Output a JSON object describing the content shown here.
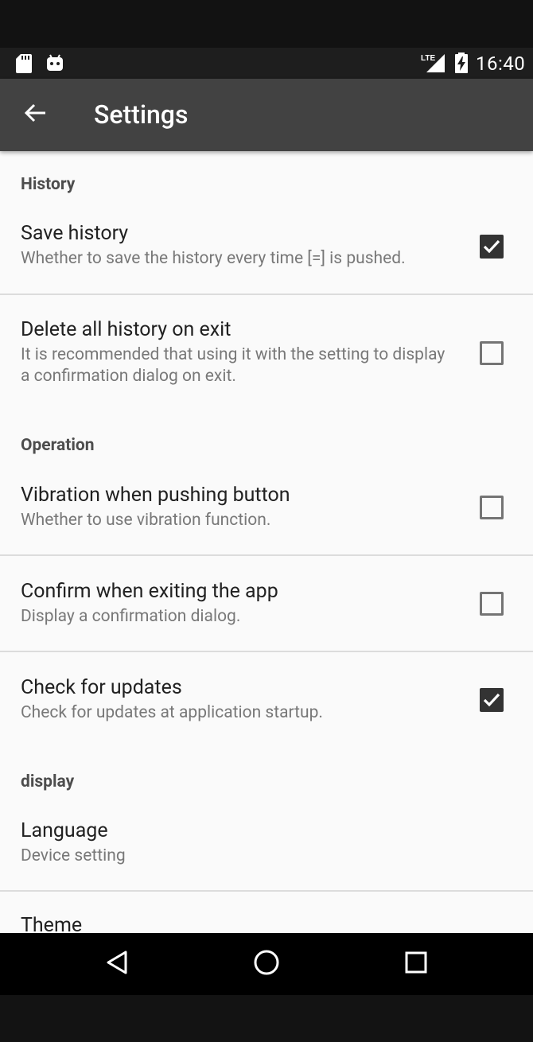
{
  "status_bar": {
    "time": "16:40",
    "network_label": "LTE",
    "icons": [
      "sd-card-icon",
      "android-icon",
      "lte-signal-icon",
      "battery-charging-icon"
    ]
  },
  "toolbar": {
    "title": "Settings",
    "back_icon": "arrow-back-icon"
  },
  "categories": {
    "history": "History",
    "operation": "Operation",
    "display": "display"
  },
  "prefs": {
    "save_history": {
      "title": "Save history",
      "summary": "Whether to save the history every time [=] is pushed.",
      "checked": true
    },
    "delete_history_on_exit": {
      "title": "Delete all history on exit",
      "summary": "It is recommended that using it with the setting to display a confirmation dialog on exit.",
      "checked": false
    },
    "vibration": {
      "title": "Vibration when pushing button",
      "summary": "Whether to use vibration function.",
      "checked": false
    },
    "confirm_exit": {
      "title": "Confirm when exiting the app",
      "summary": "Display a confirmation dialog.",
      "checked": false
    },
    "check_updates": {
      "title": "Check for updates",
      "summary": "Check for updates at application startup.",
      "checked": true
    },
    "language": {
      "title": "Language",
      "summary": "Device setting"
    },
    "theme": {
      "title": "Theme"
    }
  },
  "nav_bar": {
    "icons": [
      "back-triangle-icon",
      "home-circle-icon",
      "recents-square-icon"
    ]
  },
  "colors": {
    "toolbar": "#424242",
    "background": "#fafafa",
    "checkbox_checked": "#333333",
    "checkbox_border": "#747474"
  }
}
